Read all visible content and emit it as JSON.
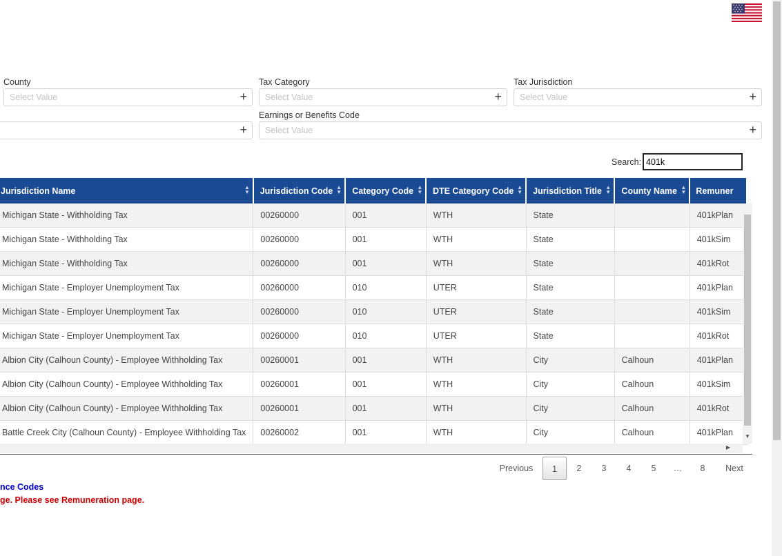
{
  "filters": {
    "county_label": "County",
    "tax_category_label": "Tax Category",
    "tax_jurisdiction_label": "Tax Jurisdiction",
    "earnings_label": "Earnings or Benefits Code",
    "placeholder": "Select Value",
    "plus": "+"
  },
  "search": {
    "label": "Search:",
    "value": "401k"
  },
  "table": {
    "headers": [
      "Jurisdiction Name",
      "Jurisdiction Code",
      "Category Code",
      "DTE Category Code",
      "Jurisdiction Title",
      "County Name",
      "Remuner"
    ],
    "rows": [
      [
        "Michigan State - Withholding Tax",
        "00260000",
        "001",
        "WTH",
        "State",
        "",
        "401kPlan"
      ],
      [
        "Michigan State - Withholding Tax",
        "00260000",
        "001",
        "WTH",
        "State",
        "",
        "401kSim"
      ],
      [
        "Michigan State - Withholding Tax",
        "00260000",
        "001",
        "WTH",
        "State",
        "",
        "401kRot"
      ],
      [
        "Michigan State - Employer Unemployment Tax",
        "00260000",
        "010",
        "UTER",
        "State",
        "",
        "401kPlan"
      ],
      [
        "Michigan State - Employer Unemployment Tax",
        "00260000",
        "010",
        "UTER",
        "State",
        "",
        "401kSim"
      ],
      [
        "Michigan State - Employer Unemployment Tax",
        "00260000",
        "010",
        "UTER",
        "State",
        "",
        "401kRot"
      ],
      [
        "Albion City (Calhoun County) - Employee Withholding Tax",
        "00260001",
        "001",
        "WTH",
        "City",
        "Calhoun",
        "401kPlan"
      ],
      [
        "Albion City (Calhoun County) - Employee Withholding Tax",
        "00260001",
        "001",
        "WTH",
        "City",
        "Calhoun",
        "401kSim"
      ],
      [
        "Albion City (Calhoun County) - Employee Withholding Tax",
        "00260001",
        "001",
        "WTH",
        "City",
        "Calhoun",
        "401kRot"
      ],
      [
        "Battle Creek City (Calhoun County) - Employee Withholding Tax",
        "00260002",
        "001",
        "WTH",
        "City",
        "Calhoun",
        "401kPlan"
      ]
    ]
  },
  "pagination": {
    "previous": "Previous",
    "pages": [
      "1",
      "2",
      "3",
      "4",
      "5",
      "…",
      "8"
    ],
    "next": "Next",
    "current": "1"
  },
  "notes": {
    "line1": "nce Codes",
    "line2": "ge. Please see Remuneration page."
  },
  "colors": {
    "header_bg": "#1a4a93",
    "note_blue": "#0000cc",
    "note_red": "#cc0000"
  },
  "icons": {
    "flag": "us-flag-icon",
    "sort": "sort-arrows-icon",
    "add": "plus-icon"
  }
}
